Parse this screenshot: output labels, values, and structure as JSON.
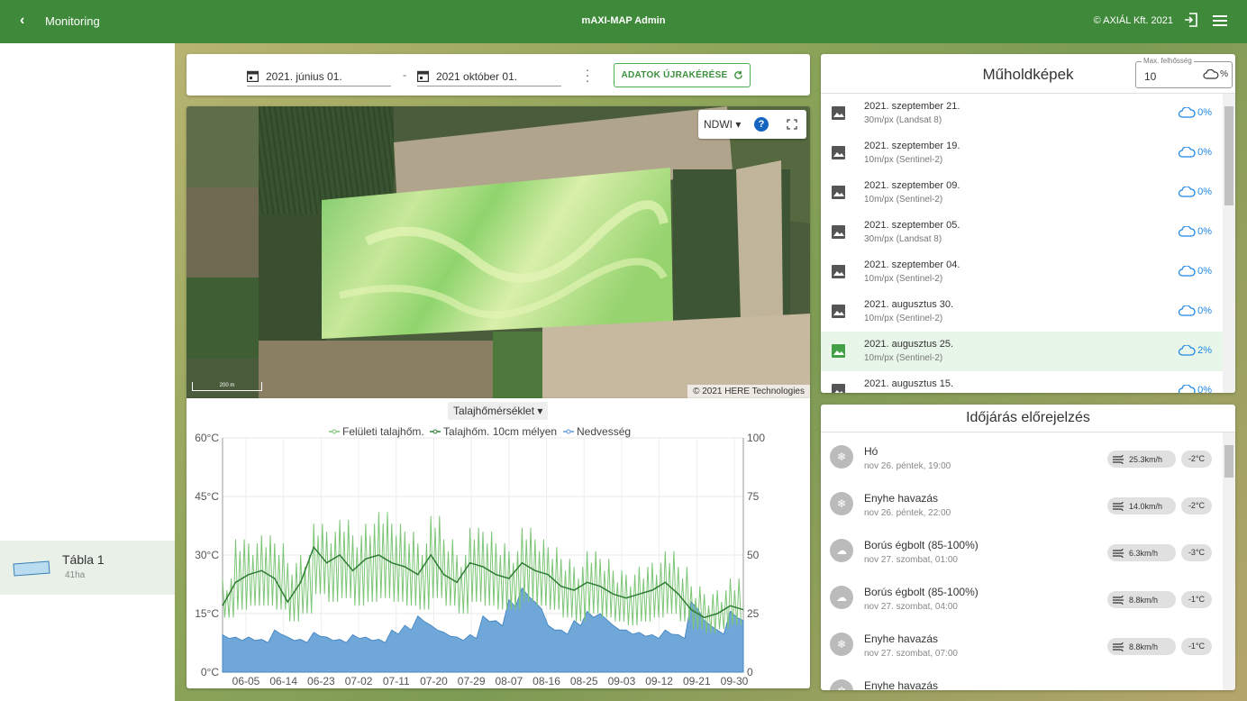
{
  "topbar": {
    "back_label": "Monitoring",
    "app_title": "mAXI-MAP Admin",
    "copyright": "© AXIÁL Kft. 2021"
  },
  "sidebar": {
    "item": {
      "name": "Tábla 1",
      "area": "41ha"
    }
  },
  "datebar": {
    "start_date": "2021. június 01.",
    "separator": "-",
    "end_date": "2021 október 01.",
    "reload_label": "ADATOK ÚJRAKÉRÉSE"
  },
  "map": {
    "layer": "NDWI",
    "help": "?",
    "scale": "200 m",
    "attribution": "© 2021 HERE Technologies"
  },
  "chart_selector": "Talajhőmérséklet",
  "chart_data": {
    "type": "line",
    "series": [
      {
        "name": "Felületi talajhőm.",
        "color": "#7cc576",
        "axis": "left",
        "kind": "line"
      },
      {
        "name": "Talajhőm. 10cm mélyen",
        "color": "#2e7d32",
        "axis": "left",
        "kind": "line"
      },
      {
        "name": "Nedvesség",
        "color": "#5b9bd5",
        "axis": "right",
        "kind": "area"
      }
    ],
    "ylim": [
      0,
      60
    ],
    "yticks": [
      "60°C",
      "45°C",
      "30°C",
      "15°C",
      "0°C"
    ],
    "y2lim": [
      0,
      100
    ],
    "y2ticks": [
      "100",
      "75",
      "50",
      "25",
      "0"
    ],
    "xticks": [
      "06-05",
      "06-14",
      "06-23",
      "07-02",
      "07-11",
      "07-20",
      "07-29",
      "08-07",
      "08-16",
      "08-25",
      "09-03",
      "09-12",
      "09-21",
      "09-30"
    ],
    "x_range": [
      "06-01",
      "09-30"
    ],
    "deep_temp_weekly": [
      17,
      23,
      25,
      26,
      24,
      18,
      23,
      32,
      28,
      30,
      26,
      29,
      30,
      28,
      27,
      25,
      30,
      25,
      23,
      28,
      27,
      25,
      24,
      28,
      26,
      25,
      22,
      21,
      23,
      22,
      20,
      19,
      20,
      21,
      23,
      20,
      16,
      14,
      15,
      17,
      16
    ],
    "surface_temp_daily_max": [
      24,
      34,
      33,
      35,
      33,
      28,
      30,
      38,
      36,
      39,
      35,
      38,
      41,
      38,
      36,
      33,
      40,
      34,
      30,
      37,
      36,
      33,
      31,
      37,
      34,
      32,
      29,
      27,
      31,
      29,
      26,
      25,
      27,
      28,
      31,
      27,
      22,
      20,
      21,
      24,
      22
    ],
    "surface_temp_daily_min": [
      14,
      16,
      17,
      17,
      16,
      13,
      15,
      20,
      18,
      19,
      17,
      18,
      19,
      18,
      17,
      16,
      19,
      17,
      15,
      18,
      17,
      16,
      16,
      18,
      17,
      16,
      14,
      13,
      15,
      14,
      13,
      12,
      13,
      14,
      15,
      13,
      11,
      10,
      11,
      12,
      11
    ],
    "moisture_weekly": [
      16,
      15,
      15,
      14,
      18,
      15,
      14,
      17,
      15,
      14,
      16,
      15,
      14,
      18,
      20,
      24,
      20,
      17,
      15,
      16,
      24,
      22,
      31,
      36,
      30,
      20,
      18,
      22,
      26,
      25,
      20,
      18,
      17,
      16,
      18,
      16,
      30,
      22,
      18,
      26,
      22
    ]
  },
  "satellite": {
    "title": "Műholdképek",
    "cloud_label": "Max. felhősség",
    "cloud_value": "10",
    "cloud_unit": "%",
    "items": [
      {
        "date": "2021. szeptember 21.",
        "res": "30m/px (Landsat 8)",
        "cloud": "0%",
        "selected": false
      },
      {
        "date": "2021. szeptember 19.",
        "res": "10m/px (Sentinel-2)",
        "cloud": "0%",
        "selected": false
      },
      {
        "date": "2021. szeptember 09.",
        "res": "10m/px (Sentinel-2)",
        "cloud": "0%",
        "selected": false
      },
      {
        "date": "2021. szeptember 05.",
        "res": "30m/px (Landsat 8)",
        "cloud": "0%",
        "selected": false
      },
      {
        "date": "2021. szeptember 04.",
        "res": "10m/px (Sentinel-2)",
        "cloud": "0%",
        "selected": false
      },
      {
        "date": "2021. augusztus 30.",
        "res": "10m/px (Sentinel-2)",
        "cloud": "0%",
        "selected": false
      },
      {
        "date": "2021. augusztus 25.",
        "res": "10m/px (Sentinel-2)",
        "cloud": "2%",
        "selected": true
      },
      {
        "date": "2021. augusztus 15.",
        "res": "",
        "cloud": "0%",
        "selected": false
      }
    ]
  },
  "weather": {
    "title": "Időjárás előrejelzés",
    "items": [
      {
        "desc": "Hó",
        "when": "nov 26. péntek, 19:00",
        "wind": "25.3km/h",
        "temp": "-2°C",
        "icon": "snow-icon"
      },
      {
        "desc": "Enyhe havazás",
        "when": "nov 26. péntek, 22:00",
        "wind": "14.0km/h",
        "temp": "-2°C",
        "icon": "snow-icon"
      },
      {
        "desc": "Borús égbolt (85-100%)",
        "when": "nov 27. szombat, 01:00",
        "wind": "6.3km/h",
        "temp": "-3°C",
        "icon": "cloud-icon"
      },
      {
        "desc": "Borús égbolt (85-100%)",
        "when": "nov 27. szombat, 04:00",
        "wind": "8.8km/h",
        "temp": "-1°C",
        "icon": "cloud-icon"
      },
      {
        "desc": "Enyhe havazás",
        "when": "nov 27. szombat, 07:00",
        "wind": "8.8km/h",
        "temp": "-1°C",
        "icon": "snow-icon"
      },
      {
        "desc": "Enyhe havazás",
        "when": "",
        "wind": "",
        "temp": "",
        "icon": "snow-icon"
      }
    ]
  }
}
